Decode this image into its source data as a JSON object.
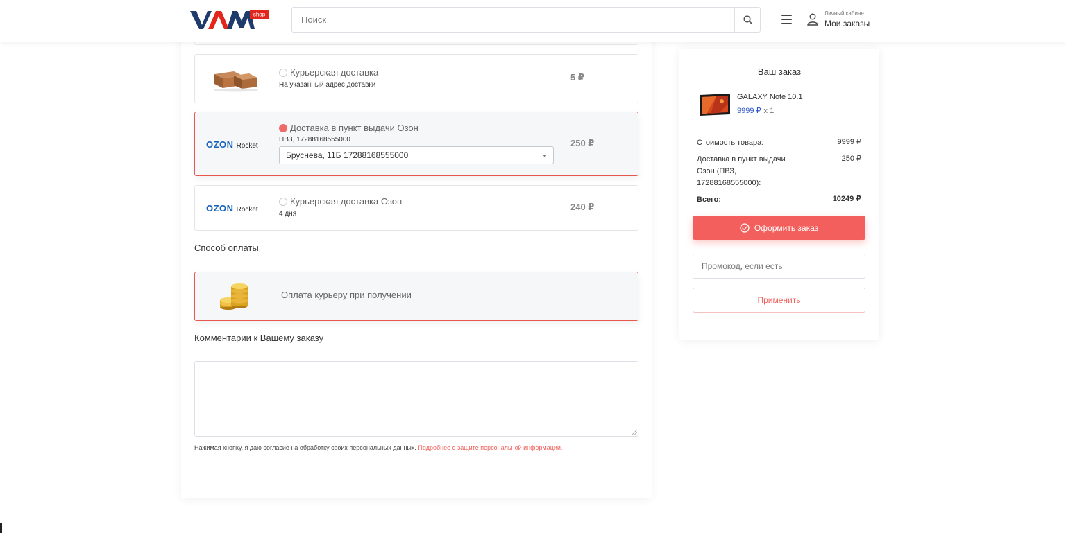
{
  "header": {
    "logo_text": "VAM",
    "logo_badge": "shop",
    "search_placeholder": "Поиск",
    "account_small": "Личный кабинет",
    "account_main": "Мои заказы"
  },
  "colors": {
    "accent": "#f25f5c",
    "ozon_blue": "#1560b8",
    "price_blue": "#2c55c7"
  },
  "delivery": {
    "options": [
      {
        "title": "Курьерская доставка",
        "subtitle": "На указанный адрес доставки",
        "price": "5 ₽",
        "selected": false,
        "icon": "boxes-icon"
      },
      {
        "title": "Доставка в пункт выдачи Озон",
        "subtitle": "ПВЗ, 17288168555000",
        "price": "250 ₽",
        "selected": true,
        "select_value": "Бруснева, 11Б 17288168555000"
      },
      {
        "title": "Курьерская доставка Озон",
        "subtitle": "4 дня",
        "price": "240 ₽",
        "selected": false
      }
    ],
    "ozon_logo": {
      "brand": "OZON",
      "suffix": "Rocket"
    }
  },
  "payment": {
    "title": "Способ оплаты",
    "option_label": "Оплата курьеру при получении",
    "icon": "coins-icon"
  },
  "comment": {
    "title": "Комментарии к Вашему заказу",
    "value": ""
  },
  "consent": {
    "text": "Нажимая кнопку, я даю согласие на обработку своих персональных данных.",
    "link": "Подробнее о защите персональной информации."
  },
  "summary": {
    "title": "Ваш заказ",
    "product": {
      "name": "GALAXY Note 10.1",
      "price": "9999 ₽",
      "qty": "x 1"
    },
    "rows": [
      {
        "label": "Стоимость товара:",
        "value": "9999 ₽"
      },
      {
        "label": "Доставка в пункт выдачи Озон (ПВЗ, 17288168555000):",
        "value": "250 ₽"
      },
      {
        "label": "Всего:",
        "value": "10249 ₽"
      }
    ],
    "order_button": "Оформить заказ",
    "promo_placeholder": "Промокод, если есть",
    "apply_button": "Применить"
  }
}
